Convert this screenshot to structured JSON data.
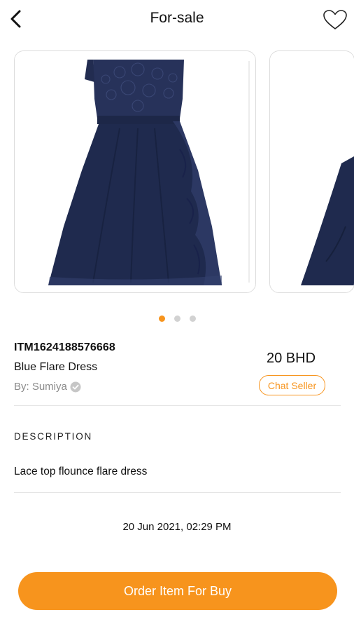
{
  "header": {
    "title": "For-sale",
    "back_icon": "chevron-left-icon",
    "favorite_icon": "heart-outline-icon"
  },
  "carousel": {
    "image_count": 3,
    "active_index": 0
  },
  "item": {
    "id": "ITM1624188576668",
    "name": "Blue Flare Dress",
    "seller_line": "By: Sumiya",
    "price": "20 BHD",
    "chat_label": "Chat Seller"
  },
  "description": {
    "heading": "DESCRIPTION",
    "text": "Lace top flounce flare dress"
  },
  "timestamp": "20 Jun 2021, 02:29 PM",
  "order_button": "Order Item For Buy",
  "colors": {
    "accent": "#f7941d",
    "dress": "#1f2a4e",
    "divider": "#e5e5e5"
  }
}
